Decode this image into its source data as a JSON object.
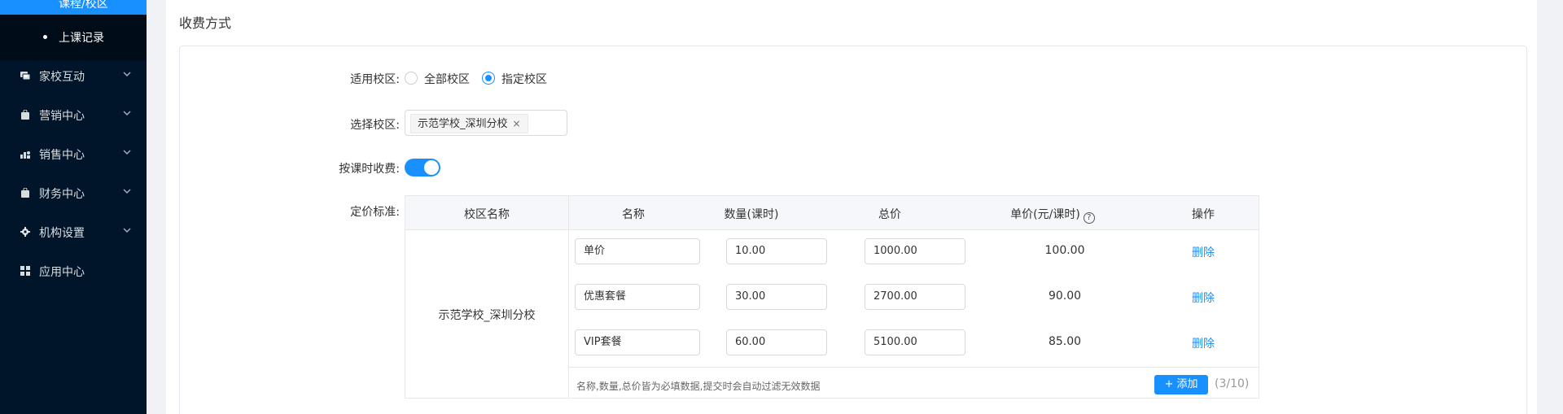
{
  "sidebar": {
    "active_item": "课程/校区",
    "sub_item": "上课记录",
    "items": [
      {
        "label": "家校互动",
        "icon": "chat-icon"
      },
      {
        "label": "营销中心",
        "icon": "bag-icon"
      },
      {
        "label": "销售中心",
        "icon": "chart-user-icon"
      },
      {
        "label": "财务中心",
        "icon": "wallet-icon"
      },
      {
        "label": "机构设置",
        "icon": "gear-icon"
      },
      {
        "label": "应用中心",
        "icon": "grid-icon"
      }
    ]
  },
  "section": {
    "title": "收费方式"
  },
  "form": {
    "campus_scope_label": "适用校区:",
    "campus_scope_options": [
      "全部校区",
      "指定校区"
    ],
    "campus_scope_selected": "指定校区",
    "select_campus_label": "选择校区:",
    "selected_campus_tag": "示范学校_深圳分校",
    "tag_close": "×",
    "per_lesson_label": "按课时收费:",
    "per_lesson_enabled": true,
    "pricing_label": "定价标准:"
  },
  "table": {
    "headers": [
      "校区名称",
      "名称",
      "数量(课时)",
      "总价",
      "单价(元/课时)",
      "操作"
    ],
    "help_glyph": "?",
    "campus_name": "示范学校_深圳分校",
    "rows": [
      {
        "name": "单价",
        "quantity": "10.00",
        "total": "1000.00",
        "unit_price": "100.00",
        "action": "删除"
      },
      {
        "name": "优惠套餐",
        "quantity": "30.00",
        "total": "2700.00",
        "unit_price": "90.00",
        "action": "删除"
      },
      {
        "name": "VIP套餐",
        "quantity": "60.00",
        "total": "5100.00",
        "unit_price": "85.00",
        "action": "删除"
      }
    ],
    "hint": "名称,数量,总价皆为必填数据,提交时会自动过滤无效数据",
    "add_label": "添加",
    "add_icon": "+",
    "count": "(3/10)"
  },
  "colors": {
    "primary": "#1890ff",
    "sidebar_bg": "#001529",
    "sidebar_sub_bg": "#000c17"
  }
}
